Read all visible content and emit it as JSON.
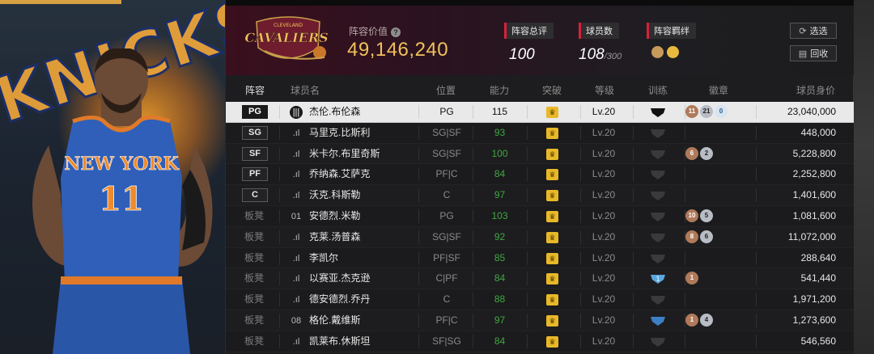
{
  "team": {
    "logo_text": "CAVALIERS",
    "logo_sub": "CLEVELAND",
    "value_label": "阵容价值",
    "value": "49,146,240"
  },
  "stats": [
    {
      "label": "阵容总评",
      "value": "100",
      "sub": ""
    },
    {
      "label": "球员数",
      "value": "108",
      "sub": "/300"
    },
    {
      "label": "阵容羁绊",
      "value": "",
      "sub": ""
    }
  ],
  "buttons": {
    "select": "选选",
    "recycle": "回收"
  },
  "left_art": {
    "team_word": "KNICKS",
    "jersey_word": "NEW YORK",
    "jersey_number": "11"
  },
  "table": {
    "headers": {
      "lineup": "阵容",
      "name": "球员名",
      "position": "位置",
      "rating": "能力",
      "breakthrough": "突破",
      "level": "等级",
      "training": "训练",
      "badges": "徽章",
      "value": "球员身价"
    },
    "rows": [
      {
        "slot": "PG",
        "bench": false,
        "sig": "|||",
        "name": "杰伦.布伦森",
        "position": "PG",
        "rating": "115",
        "level": "Lv.20",
        "train": "dark",
        "badges": [
          {
            "t": "b",
            "v": "11"
          },
          {
            "t": "s",
            "v": "21"
          },
          {
            "t": "g",
            "v": "0"
          }
        ],
        "value": "23,040,000",
        "selected": true
      },
      {
        "slot": "SG",
        "bench": false,
        "sig": ".ıl",
        "name": "马里克.比斯利",
        "position": "SG|SF",
        "rating": "93",
        "level": "Lv.20",
        "train": "grey",
        "badges": [],
        "value": "448,000"
      },
      {
        "slot": "SF",
        "bench": false,
        "sig": ".ıl",
        "name": "米卡尔.布里奇斯",
        "position": "SG|SF",
        "rating": "100",
        "level": "Lv.20",
        "train": "grey",
        "badges": [
          {
            "t": "b",
            "v": "6"
          },
          {
            "t": "s",
            "v": "2"
          }
        ],
        "value": "5,228,800"
      },
      {
        "slot": "PF",
        "bench": false,
        "sig": ".ıl",
        "name": "乔纳森.艾萨克",
        "position": "PF|C",
        "rating": "84",
        "level": "Lv.20",
        "train": "grey",
        "badges": [],
        "value": "2,252,800"
      },
      {
        "slot": "C",
        "bench": false,
        "sig": ".ıl",
        "name": "沃克.科斯勒",
        "position": "C",
        "rating": "97",
        "level": "Lv.20",
        "train": "grey",
        "badges": [],
        "value": "1,401,600"
      },
      {
        "slot": "板凳",
        "bench": true,
        "sig": "01",
        "name": "安德烈.米勒",
        "position": "PG",
        "rating": "103",
        "level": "Lv.20",
        "train": "grey",
        "badges": [
          {
            "t": "b",
            "v": "10"
          },
          {
            "t": "s",
            "v": "5"
          }
        ],
        "value": "1,081,600"
      },
      {
        "slot": "板凳",
        "bench": true,
        "sig": ".ıl",
        "name": "克莱.汤普森",
        "position": "SG|SF",
        "rating": "92",
        "level": "Lv.20",
        "train": "grey",
        "badges": [
          {
            "t": "b",
            "v": "8"
          },
          {
            "t": "s",
            "v": "6"
          }
        ],
        "value": "11,072,000"
      },
      {
        "slot": "板凳",
        "bench": true,
        "sig": ".ıl",
        "name": "李凯尔",
        "position": "PF|SF",
        "rating": "85",
        "level": "Lv.20",
        "train": "grey",
        "badges": [],
        "value": "288,640"
      },
      {
        "slot": "板凳",
        "bench": true,
        "sig": ".ıl",
        "name": "以赛亚.杰克逊",
        "position": "C|PF",
        "rating": "84",
        "level": "Lv.20",
        "train": "blue1",
        "badges": [
          {
            "t": "b",
            "v": "1"
          }
        ],
        "value": "541,440"
      },
      {
        "slot": "板凳",
        "bench": true,
        "sig": ".ıl",
        "name": "德安德烈.乔丹",
        "position": "C",
        "rating": "88",
        "level": "Lv.20",
        "train": "grey",
        "badges": [],
        "value": "1,971,200"
      },
      {
        "slot": "板凳",
        "bench": true,
        "sig": "08",
        "name": "格伦.戴维斯",
        "position": "PF|C",
        "rating": "97",
        "level": "Lv.20",
        "train": "blue",
        "badges": [
          {
            "t": "b",
            "v": "1"
          },
          {
            "t": "s",
            "v": "4"
          }
        ],
        "value": "1,273,600"
      },
      {
        "slot": "板凳",
        "bench": true,
        "sig": ".ıl",
        "name": "凯莱布.休斯坦",
        "position": "SF|SG",
        "rating": "84",
        "level": "Lv.20",
        "train": "grey",
        "badges": [],
        "value": "546,560"
      }
    ]
  }
}
